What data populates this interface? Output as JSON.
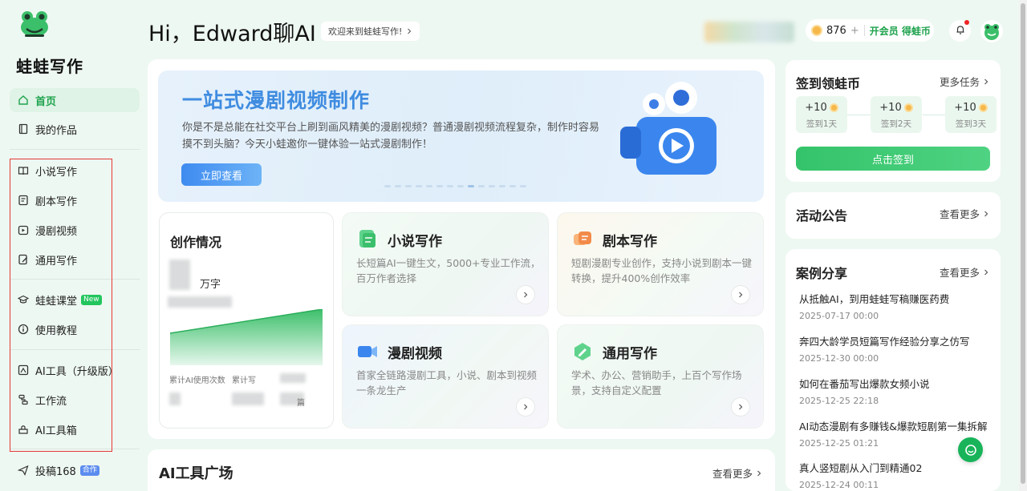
{
  "brand": {
    "name": "蛙蛙写作"
  },
  "sidebar": {
    "items": [
      {
        "label": "首页",
        "icon": "home-icon",
        "active": true
      },
      {
        "label": "我的作品",
        "icon": "book-icon"
      },
      {
        "label": "小说写作",
        "icon": "open-book-icon"
      },
      {
        "label": "剧本写作",
        "icon": "script-icon"
      },
      {
        "label": "漫剧视频",
        "icon": "video-icon"
      },
      {
        "label": "通用写作",
        "icon": "edit-doc-icon"
      },
      {
        "label": "蛙蛙课堂",
        "icon": "graduation-cap-icon",
        "badge": "New"
      },
      {
        "label": "使用教程",
        "icon": "info-icon"
      },
      {
        "label": "AI工具（升级版）",
        "icon": "ai-tool-icon"
      },
      {
        "label": "工作流",
        "icon": "workflow-icon"
      },
      {
        "label": "AI工具箱",
        "icon": "toolbox-icon"
      },
      {
        "label": "投稿168",
        "icon": "send-icon",
        "badge": "合作"
      }
    ]
  },
  "header": {
    "greeting": "Hi，Edward聊AI",
    "welcome": "欢迎来到蛙蛙写作!",
    "coins": "876",
    "coin_plus": "+",
    "vip": "开会员 得蛙币"
  },
  "banner": {
    "title": "一站式漫剧视频制作",
    "desc": "你是不是总能在社交平台上刷到画风精美的漫剧视频？普通漫剧视频流程复杂，制作时容易摸不到头脑？今天小蛙邀你一键体验一站式漫剧制作！",
    "button": "立即查看"
  },
  "stats": {
    "title": "创作情况",
    "unit": "万字",
    "label1": "累计AI使用次数",
    "label2": "累计写",
    "tail": "篇"
  },
  "features": [
    {
      "title": "小说写作",
      "desc": "长短篇AI一键生文，5000+专业工作流，百万作者选择"
    },
    {
      "title": "剧本写作",
      "desc": "短剧漫剧专业创作，支持小说到剧本一键转换，提升400%创作效率"
    },
    {
      "title": "漫剧视频",
      "desc": "首家全链路漫剧工具，小说、剧本到视频一条龙生产"
    },
    {
      "title": "通用写作",
      "desc": "学术、办公、营销助手，上百个写作场景，支持自定义配置"
    }
  ],
  "tools": {
    "title": "AI工具广场",
    "more": "查看更多"
  },
  "signin": {
    "title": "签到领蛙币",
    "more": "更多任务",
    "days": [
      {
        "points": "+10",
        "label": "签到1天"
      },
      {
        "points": "+10",
        "label": "签到2天"
      },
      {
        "points": "+10",
        "label": "签到3天"
      }
    ],
    "button": "点击签到"
  },
  "notice": {
    "title": "活动公告",
    "more": "查看更多"
  },
  "cases": {
    "title": "案例分享",
    "more": "查看更多",
    "items": [
      {
        "title": "从抵触AI，到用蛙蛙写稿赚医药费",
        "time": "2025-07-17 00:00"
      },
      {
        "title": "奔四大龄学员短篇写作经验分享之仿写",
        "time": "2025-12-30 00:00"
      },
      {
        "title": "如何在番茄写出爆款女频小说",
        "time": "2025-12-25 22:18"
      },
      {
        "title": "AI动态漫剧有多赚钱&爆款短剧第一集拆解",
        "time": "2025-12-25 01:21"
      },
      {
        "title": "真人竖短剧从入门到精通02",
        "time": "2025-12-24 00:11"
      }
    ]
  },
  "colors": {
    "accent": "#1fa34d",
    "banner_title": "#3f8ce0",
    "signin_button": "#34c36a"
  }
}
